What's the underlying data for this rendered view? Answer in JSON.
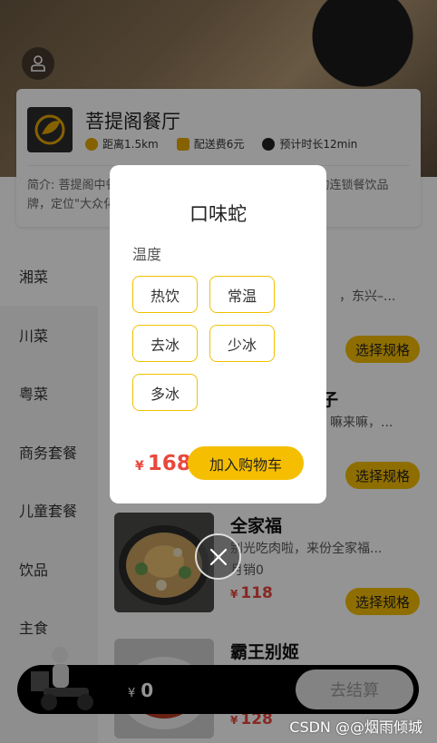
{
  "shop": {
    "name": "菩提阁餐厅",
    "distance": "距离1.5km",
    "delivery_fee": "配送费6元",
    "eta": "预计时长12min",
    "intro": "简介: 菩提阁中餐厅是一家集餐饮服务和品牌运营于一体的连锁餐饮品牌，定位\"大众化的美食外送\""
  },
  "categories": [
    "湘菜",
    "川菜",
    "粤菜",
    "商务套餐",
    "儿童套餐",
    "饮品",
    "主食"
  ],
  "dishes": [
    {
      "name": "",
      "desc": "，东兴–...",
      "sales": "",
      "price": "",
      "button": "选择规格"
    },
    {
      "name": "子",
      "desc": "嘛来嘛，...",
      "sales": "",
      "price": "",
      "button": "选择规格"
    },
    {
      "name": "全家福",
      "desc": "别光吃肉啦，来份全家福...",
      "sales": "月销0",
      "price": "118",
      "button": "选择规格"
    },
    {
      "name": "霸王别姬",
      "desc": "",
      "sales": "",
      "price": "128",
      "button": ""
    }
  ],
  "cart": {
    "currency": "¥",
    "total": "0",
    "checkout": "去结算"
  },
  "modal": {
    "title": "口味蛇",
    "label": "温度",
    "options": [
      "热饮",
      "常温",
      "去冰",
      "少冰",
      "多冰"
    ],
    "currency": "¥",
    "price": "168",
    "add_button": "加入购物车"
  },
  "watermark": "CSDN @@烟雨倾城",
  "colors": {
    "accent": "#f5be00",
    "price": "#e8483d"
  }
}
